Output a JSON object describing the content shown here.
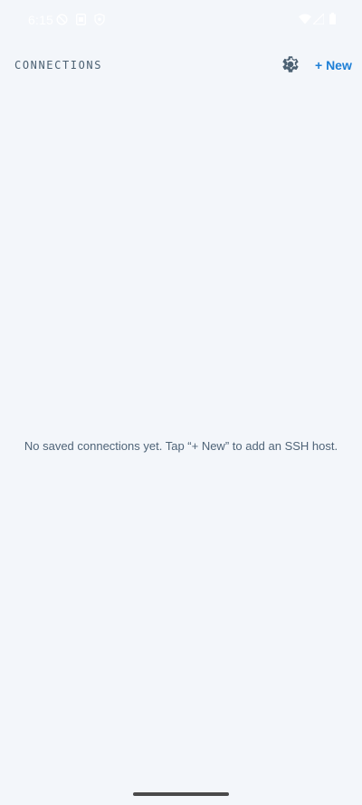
{
  "status_bar": {
    "time": "6:15",
    "left_icons": [
      "do-not-disturb-icon",
      "notification-icon",
      "shield-icon"
    ],
    "right_icons": [
      "wifi-icon",
      "signal-icon",
      "battery-icon"
    ]
  },
  "header": {
    "title": "CONNECTIONS",
    "settings_icon": "gear-icon",
    "new_label": "+ New"
  },
  "empty_state": {
    "message": "No saved connections yet. Tap “+ New” to add an SSH host."
  },
  "colors": {
    "background": "#f3f6fa",
    "title": "#4c6173",
    "accent": "#1d7fd6",
    "message": "#4f6478"
  }
}
